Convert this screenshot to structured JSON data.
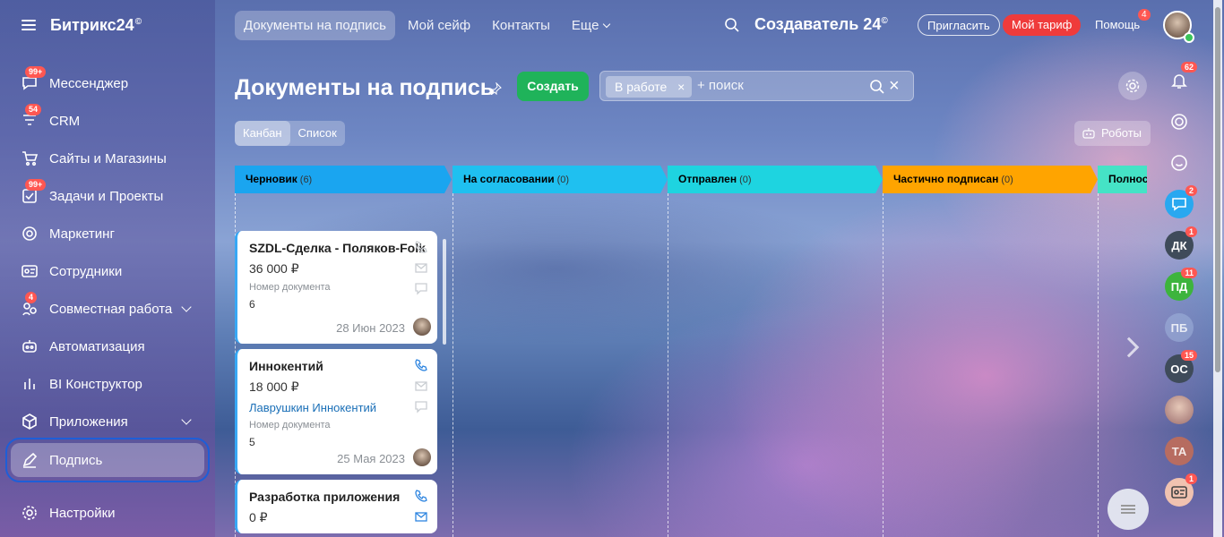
{
  "app": {
    "logo": "Битрикс24",
    "logo_mark": "©"
  },
  "sidebar": {
    "items": [
      {
        "label": "Мессенджер",
        "badge": "99+"
      },
      {
        "label": "CRM",
        "badge": "54"
      },
      {
        "label": "Сайты и Магазины",
        "badge": ""
      },
      {
        "label": "Задачи и Проекты",
        "badge": "99+"
      },
      {
        "label": "Маркетинг",
        "badge": ""
      },
      {
        "label": "Сотрудники",
        "badge": ""
      },
      {
        "label": "Совместная работа",
        "badge": "4"
      },
      {
        "label": "Автоматизация",
        "badge": ""
      },
      {
        "label": "BI Конструктор",
        "badge": ""
      },
      {
        "label": "Приложения",
        "badge": ""
      },
      {
        "label": "Подпись",
        "badge": ""
      }
    ],
    "settings": "Настройки"
  },
  "topbar": {
    "tabs": [
      "Документы на подпись",
      "Мой сейф",
      "Контакты"
    ],
    "more": "Еще",
    "brand": "Создаватель 24",
    "brand_mark": "©",
    "invite": "Пригласить",
    "tariff": "Мой тариф",
    "help": "Помощь",
    "help_badge": "4"
  },
  "page": {
    "title": "Документы на подпись",
    "create": "Создать",
    "filter_chip": "В работе",
    "filter_placeholder": "+ поиск",
    "view_kanban": "Канбан",
    "view_list": "Список",
    "robots": "Роботы"
  },
  "stages": [
    {
      "name": "Черновик",
      "count": "(6)",
      "color": "#1aa5f0"
    },
    {
      "name": "На согласовании",
      "count": "(0)",
      "color": "#1fc0f0"
    },
    {
      "name": "Отправлен",
      "count": "(0)",
      "color": "#1ed4e0"
    },
    {
      "name": "Частично подписан",
      "count": "(0)",
      "color": "#ffa400"
    },
    {
      "name": "Полност",
      "count": "",
      "color": "#45e3c6"
    }
  ],
  "cards": [
    {
      "title": "SZDL-Сделка - Поляков-Folk",
      "sum": "36 000 ₽",
      "link": "",
      "label": "Номер документа",
      "value": "6",
      "date": "28 Июн 2023"
    },
    {
      "title": "Иннокентий",
      "sum": "18 000 ₽",
      "link": "Лаврушкин Иннокентий",
      "label": "Номер документа",
      "value": "5",
      "date": "25 Мая 2023"
    },
    {
      "title": "Разработка приложения",
      "sum": "0 ₽",
      "link": "",
      "label": "",
      "value": "",
      "date": ""
    }
  ],
  "right_rail": {
    "bell_badge": "62",
    "chat_badge": "2",
    "dk": {
      "initials": "ДК",
      "badge": "1"
    },
    "pd": {
      "initials": "ПД",
      "badge": "11"
    },
    "pb": {
      "initials": "ПБ"
    },
    "os": {
      "initials": "ОС",
      "badge": "15"
    },
    "ta": {
      "initials": "ТА"
    },
    "card_badge": "1"
  }
}
